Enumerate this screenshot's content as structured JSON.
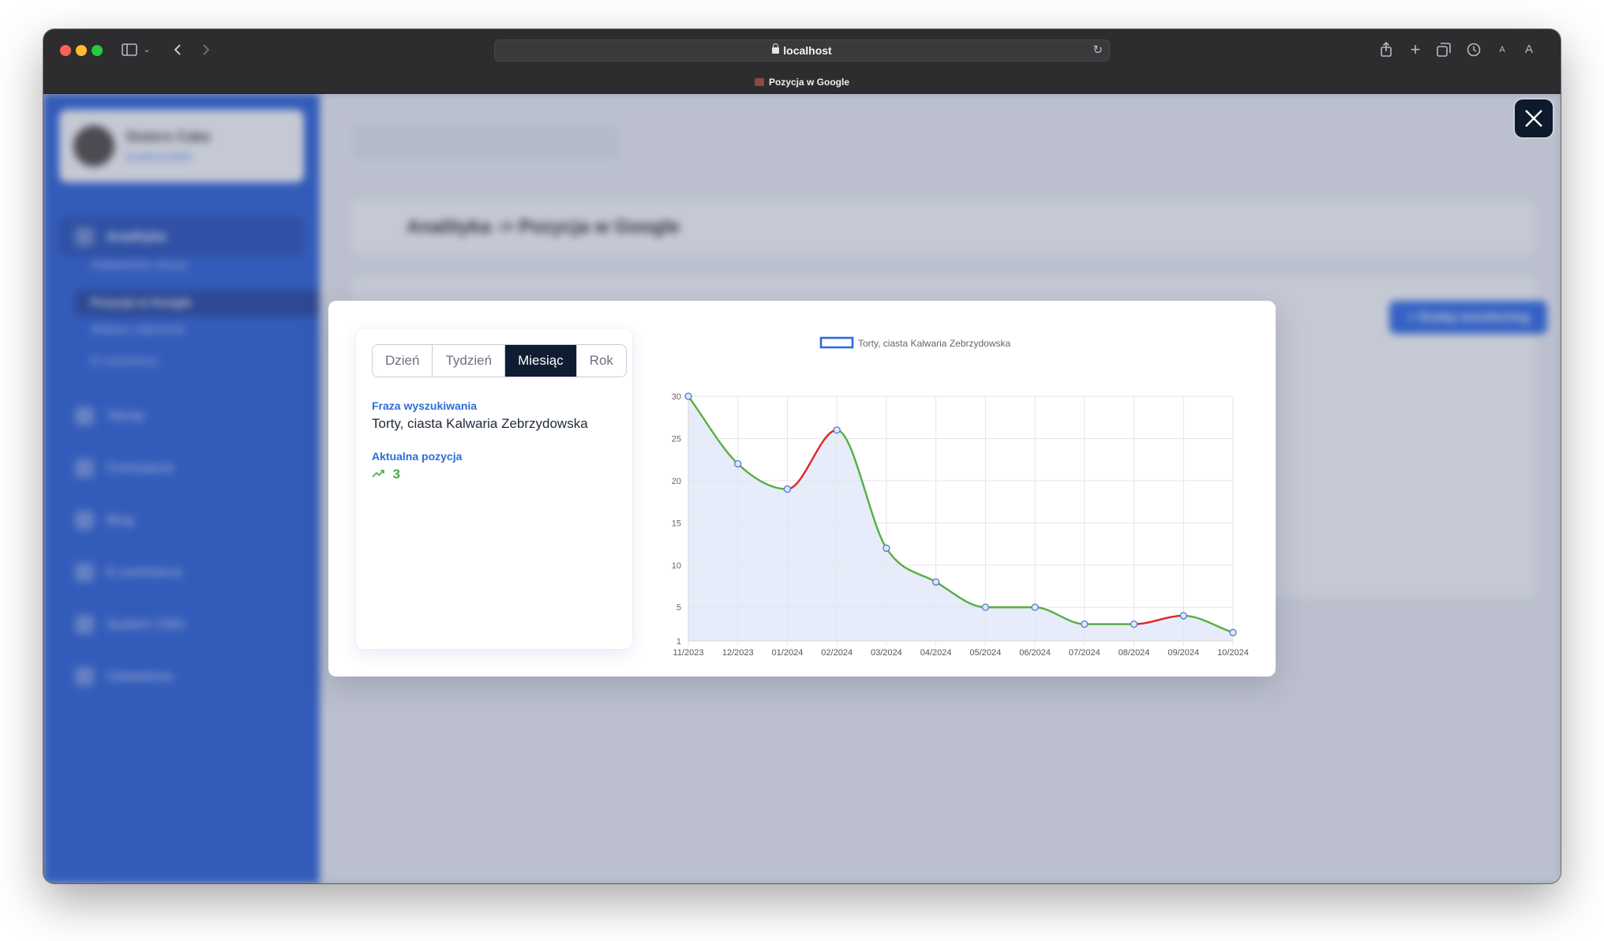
{
  "browser": {
    "url": "localhost",
    "tab_title": "Pozycja w Google",
    "icons": [
      "sidebar-icon",
      "chevron-down-icon",
      "back-icon",
      "forward-icon",
      "reload-icon",
      "share-icon",
      "new-tab-icon",
      "tab-overview-icon",
      "history-icon",
      "text-small-icon",
      "text-large-icon"
    ]
  },
  "background_app": {
    "brand_name": "Sisters Cake",
    "brand_sub": "localhost:3000",
    "breadcrumb": "Analityka -> Pozycja w Google",
    "add_button": "+ Dodaj monitoring",
    "nav": [
      "Analityka",
      "Teksty",
      "Formularze",
      "Blog",
      "E-commerce",
      "System CMS",
      "Ustawienia"
    ],
    "subnav": [
      "Odwiedziny strony",
      "Pozycja w Google",
      "Własne zdarzenia",
      "E-commerce"
    ]
  },
  "modal": {
    "tabs": [
      "Dzień",
      "Tydzień",
      "Miesiąc",
      "Rok"
    ],
    "active_tab": "Miesiąc",
    "phrase_label": "Fraza wyszukiwania",
    "phrase_value": "Torty, ciasta Kalwaria Zebrzydowska",
    "position_label": "Aktualna pozycja",
    "position_value": "3",
    "trend_icon": "trend-up-icon"
  },
  "chart_data": {
    "type": "line",
    "legend": [
      "Torty, ciasta Kalwaria Zebrzydowska"
    ],
    "legend_position": "top",
    "categories": [
      "11/2023",
      "12/2023",
      "01/2024",
      "02/2024",
      "03/2024",
      "04/2024",
      "05/2024",
      "06/2024",
      "07/2024",
      "08/2024",
      "09/2024",
      "10/2024"
    ],
    "series": [
      {
        "name": "Torty, ciasta Kalwaria Zebrzydowska",
        "values": [
          30,
          22,
          19,
          26,
          12,
          8,
          5,
          5,
          3,
          3,
          4,
          2
        ]
      }
    ],
    "y_ticks": [
      1,
      5,
      10,
      15,
      20,
      25,
      30
    ],
    "ylim": [
      1,
      30
    ],
    "grid": true,
    "fill": true,
    "colors": {
      "improving": "#5aad42",
      "worsening": "#e02525",
      "point_stroke": "#4f7bc8",
      "fill": "#e6ecfa",
      "legend_border": "#2f6ae0"
    }
  }
}
